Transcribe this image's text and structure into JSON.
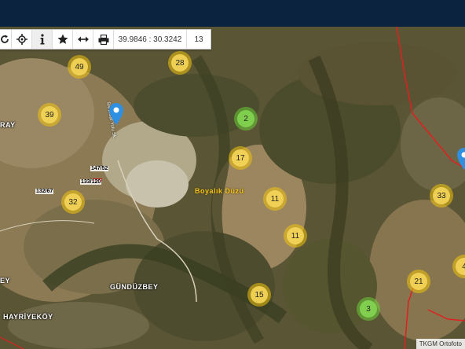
{
  "toolbar": {
    "coordinates": "39.9846 : 30.3242",
    "zoom": "13",
    "icons": [
      "refresh-icon",
      "locate-icon",
      "info-icon",
      "star-icon",
      "measure-icon",
      "print-icon"
    ]
  },
  "clusters": [
    {
      "count": "49",
      "color": "yellow"
    },
    {
      "count": "28",
      "color": "yellow"
    },
    {
      "count": "39",
      "color": "yellow"
    },
    {
      "count": "2",
      "color": "green"
    },
    {
      "count": "17",
      "color": "yellow"
    },
    {
      "count": "11",
      "color": "yellow"
    },
    {
      "count": "11",
      "color": "yellow"
    },
    {
      "count": "32",
      "color": "yellow"
    },
    {
      "count": "33",
      "color": "yellow"
    },
    {
      "count": "21",
      "color": "yellow"
    },
    {
      "count": "15",
      "color": "yellow"
    },
    {
      "count": "3",
      "color": "green"
    },
    {
      "count": "4",
      "color": "yellow"
    }
  ],
  "places": {
    "ray": "RAY",
    "boyalik": "Boyalık Düzü",
    "gunduzbey": "GÜNDÜZBEY",
    "hayriyekoy": "HAYRİYEKÖY",
    "ey": "EY",
    "road": "Sivrihisar Yolu Sk."
  },
  "parcels": {
    "p1": "147/52",
    "p2": "133/120",
    "p3": "132/67"
  },
  "attribution": "TKGM Ortofoto"
}
